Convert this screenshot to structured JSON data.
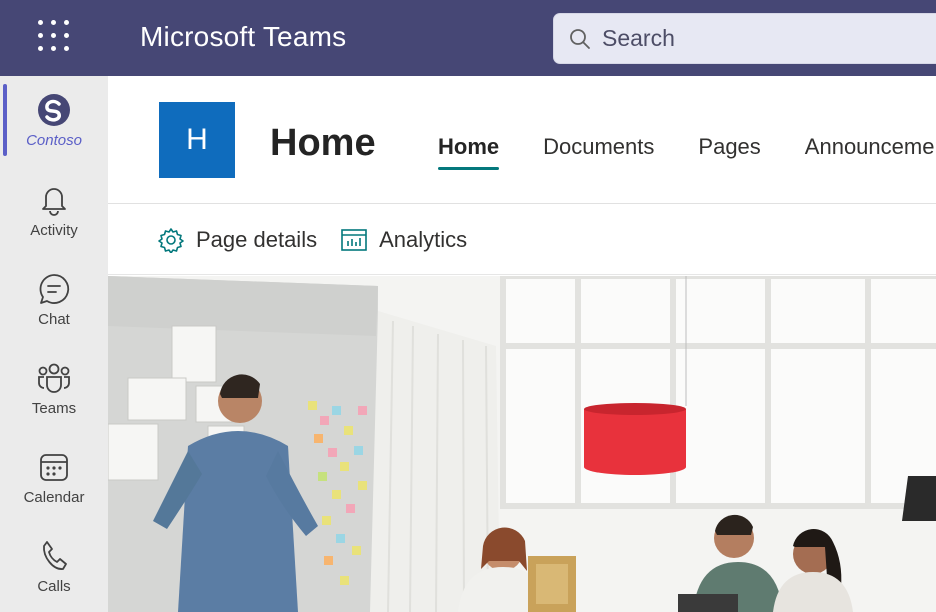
{
  "app": {
    "title": "Microsoft Teams"
  },
  "search": {
    "placeholder": "Search"
  },
  "rail": {
    "items": [
      {
        "label": "Contoso",
        "icon": "contoso-logo-icon",
        "active": true
      },
      {
        "label": "Activity",
        "icon": "bell-icon"
      },
      {
        "label": "Chat",
        "icon": "chat-icon"
      },
      {
        "label": "Teams",
        "icon": "teams-icon"
      },
      {
        "label": "Calendar",
        "icon": "calendar-icon"
      },
      {
        "label": "Calls",
        "icon": "phone-icon"
      }
    ]
  },
  "site": {
    "logo_letter": "H",
    "title": "Home",
    "tabs": [
      {
        "label": "Home",
        "active": true
      },
      {
        "label": "Documents"
      },
      {
        "label": "Pages"
      },
      {
        "label": "Announcements"
      }
    ]
  },
  "commands": {
    "page_details": "Page details",
    "analytics": "Analytics"
  },
  "hero": {
    "description_icon": "hero-image"
  },
  "colors": {
    "topbar": "#464775",
    "accent": "#5b5fc7",
    "tab_underline": "#03787c",
    "site_logo": "#0f6cbd"
  }
}
